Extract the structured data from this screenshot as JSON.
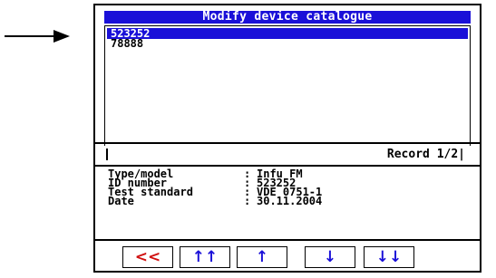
{
  "window": {
    "title": "Modify device catalogue"
  },
  "devices": [
    {
      "id": "523252",
      "selected": true
    },
    {
      "id": "78888",
      "selected": false
    }
  ],
  "status": {
    "record": "Record 1/2|"
  },
  "details": [
    {
      "label": "Type/model",
      "value": "Infu FM"
    },
    {
      "label": "ID number",
      "value": "523252"
    },
    {
      "label": "Test standard",
      "value": "VDE 0751-1"
    },
    {
      "label": "Date",
      "value": "30.11.2004"
    }
  ],
  "buttons": [
    {
      "icon": "double-left-icon",
      "glyph": "<<",
      "color": "#d01010"
    },
    {
      "icon": "double-up-icon",
      "glyph": "↑↑",
      "color": "#1a10d8"
    },
    {
      "icon": "up-icon",
      "glyph": "↑",
      "color": "#1a10d8"
    },
    {
      "icon": "down-icon",
      "glyph": "↓",
      "color": "#1a10d8"
    },
    {
      "icon": "double-down-icon",
      "glyph": "↓↓",
      "color": "#1a10d8"
    }
  ],
  "pointer": {
    "icon": "arrow-right-icon"
  }
}
